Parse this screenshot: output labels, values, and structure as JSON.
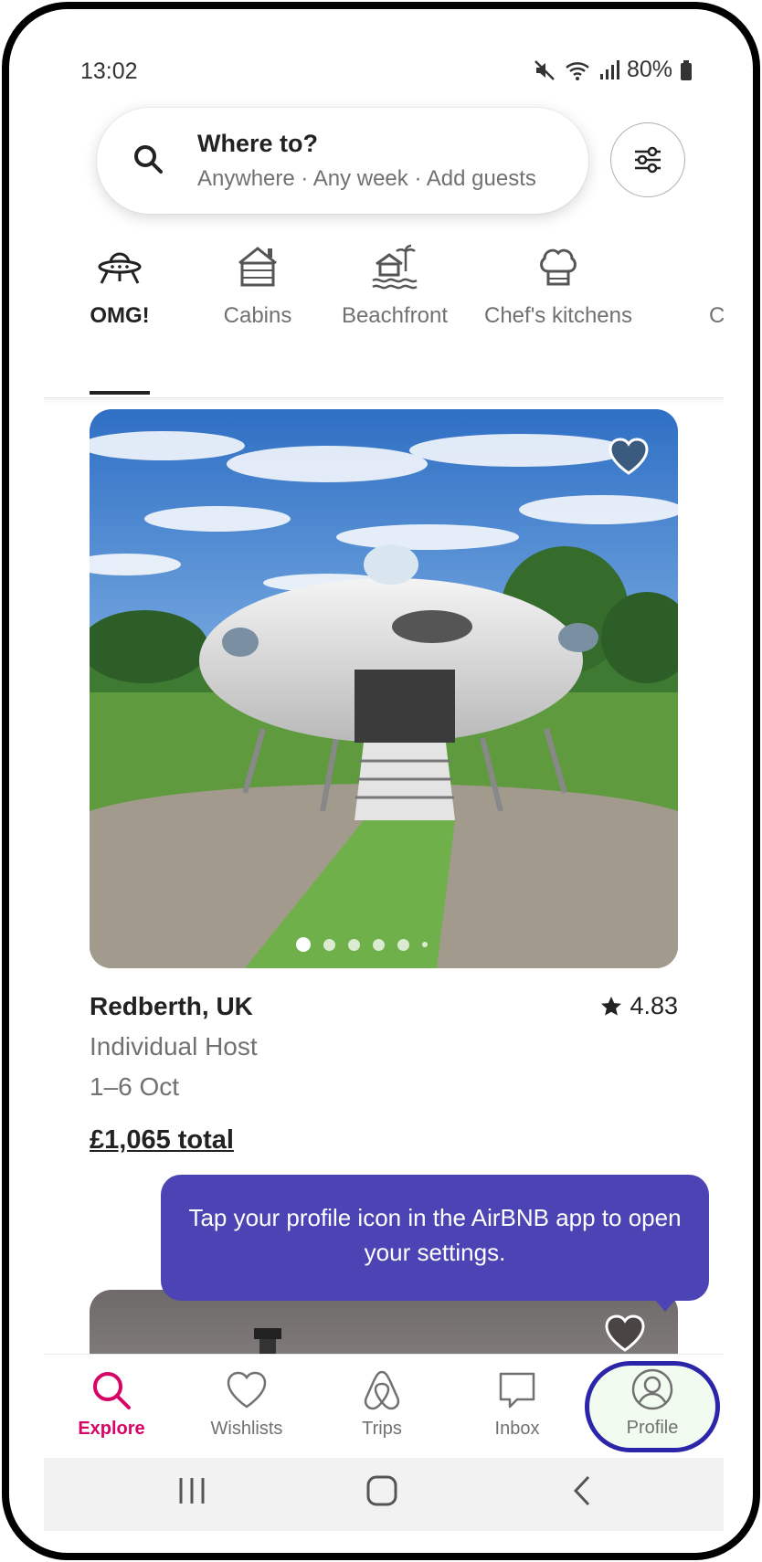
{
  "status_bar": {
    "time": "13:02",
    "battery": "80%"
  },
  "search": {
    "title": "Where to?",
    "subtitle": "Anywhere · Any week · Add guests"
  },
  "categories": [
    {
      "label": "OMG!",
      "icon": "ufo-icon",
      "active": true
    },
    {
      "label": "Cabins",
      "icon": "cabin-icon",
      "active": false
    },
    {
      "label": "Beachfront",
      "icon": "beachfront-icon",
      "active": false
    },
    {
      "label": "Chef's kitchens",
      "icon": "chef-hat-icon",
      "active": false
    },
    {
      "label": "C",
      "icon": "",
      "active": false
    }
  ],
  "listing": {
    "location": "Redberth, UK",
    "rating": "4.83",
    "host": "Individual Host",
    "dates": "1–6 Oct",
    "price": "£1,065 total",
    "photo_count_visible_dots": 6,
    "active_photo_index": 0
  },
  "tooltip": {
    "text": "Tap your profile icon in the AirBNB app to open your settings."
  },
  "bottom_nav": [
    {
      "label": "Explore",
      "icon": "search-icon",
      "active": true
    },
    {
      "label": "Wishlists",
      "icon": "heart-icon",
      "active": false
    },
    {
      "label": "Trips",
      "icon": "airbnb-logo-icon",
      "active": false
    },
    {
      "label": "Inbox",
      "icon": "message-icon",
      "active": false
    },
    {
      "label": "Profile",
      "icon": "profile-icon",
      "active": false,
      "highlighted": true
    }
  ],
  "colors": {
    "accent": "#d70466",
    "tooltip": "#4c44b5",
    "highlight_ring": "#2b26a9",
    "text_primary": "#222222",
    "text_secondary": "#717171"
  }
}
